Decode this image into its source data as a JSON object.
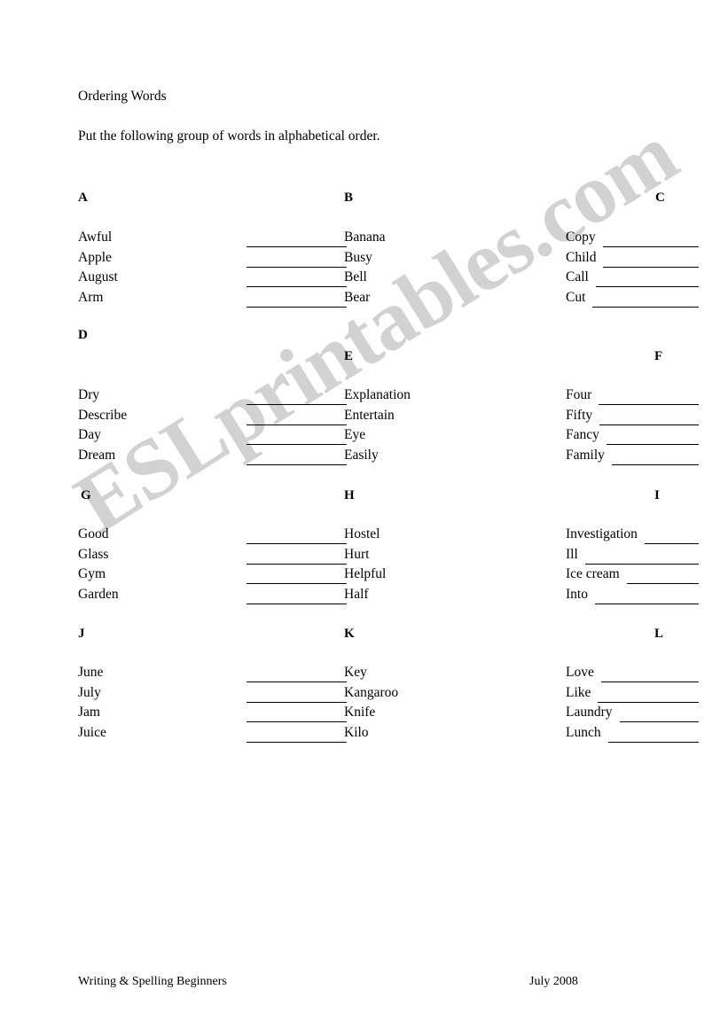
{
  "document": {
    "title": "Ordering Words",
    "instruction": "Put the following group of words in alphabetical order."
  },
  "watermark": {
    "text": "ESLprintables.com",
    "color": "#d2d2d2"
  },
  "groups": [
    {
      "letter": "A",
      "words": [
        "Awful",
        "Apple",
        "August",
        "Arm"
      ]
    },
    {
      "letter": "B",
      "words": [
        "Banana",
        "Busy",
        "Bell",
        "Bear"
      ]
    },
    {
      "letter": "C",
      "words": [
        "Copy",
        "Child",
        "Call",
        "Cut"
      ]
    },
    {
      "letter": "D",
      "words": [
        "Dry",
        "Describe",
        "Day",
        "Dream"
      ]
    },
    {
      "letter": "E",
      "words": [
        "Explanation",
        "Entertain",
        "Eye",
        "Easily"
      ]
    },
    {
      "letter": "F",
      "words": [
        "Four",
        "Fifty",
        "Fancy",
        "Family"
      ]
    },
    {
      "letter": "G",
      "words": [
        "Good",
        "Glass",
        "Gym",
        "Garden"
      ]
    },
    {
      "letter": "H",
      "words": [
        "Hostel",
        "Hurt",
        "Helpful",
        "Half"
      ]
    },
    {
      "letter": "I",
      "words": [
        "Investigation",
        "Ill",
        "Ice cream",
        "Into"
      ]
    },
    {
      "letter": "J",
      "words": [
        "June",
        "July",
        "Jam",
        "Juice"
      ]
    },
    {
      "letter": "K",
      "words": [
        "Key",
        "Kangaroo",
        "Knife",
        "Kilo"
      ]
    },
    {
      "letter": "L",
      "words": [
        "Love",
        "Like",
        "Laundry",
        "Lunch"
      ]
    }
  ],
  "footer": {
    "left": "Writing & Spelling Beginners",
    "right": "July 2008"
  }
}
